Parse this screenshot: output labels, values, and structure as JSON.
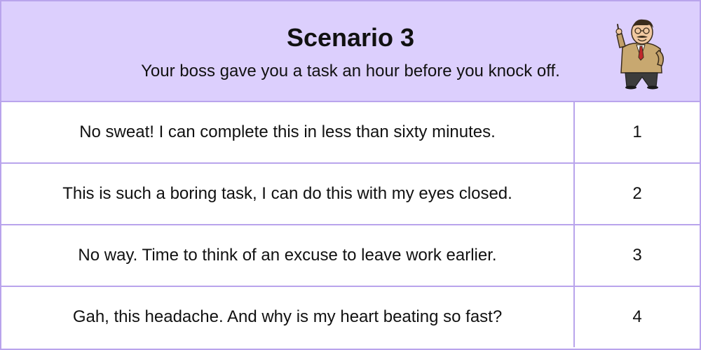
{
  "header": {
    "title": "Scenario 3",
    "subtitle": "Your boss gave you a task an hour before you knock off.",
    "illustration": "boss-cartoon-icon"
  },
  "options": [
    {
      "text": "No sweat! I can complete this in less than sixty minutes.",
      "number": "1"
    },
    {
      "text": "This is such a boring task, I can do this with my eyes closed.",
      "number": "2"
    },
    {
      "text": "No way. Time to think of an excuse to leave work earlier.",
      "number": "3"
    },
    {
      "text": "Gah, this headache. And why is my heart beating so fast?",
      "number": "4"
    }
  ],
  "colors": {
    "header_background": "#dccffd",
    "border": "#b9a4ec",
    "text": "#111111"
  }
}
